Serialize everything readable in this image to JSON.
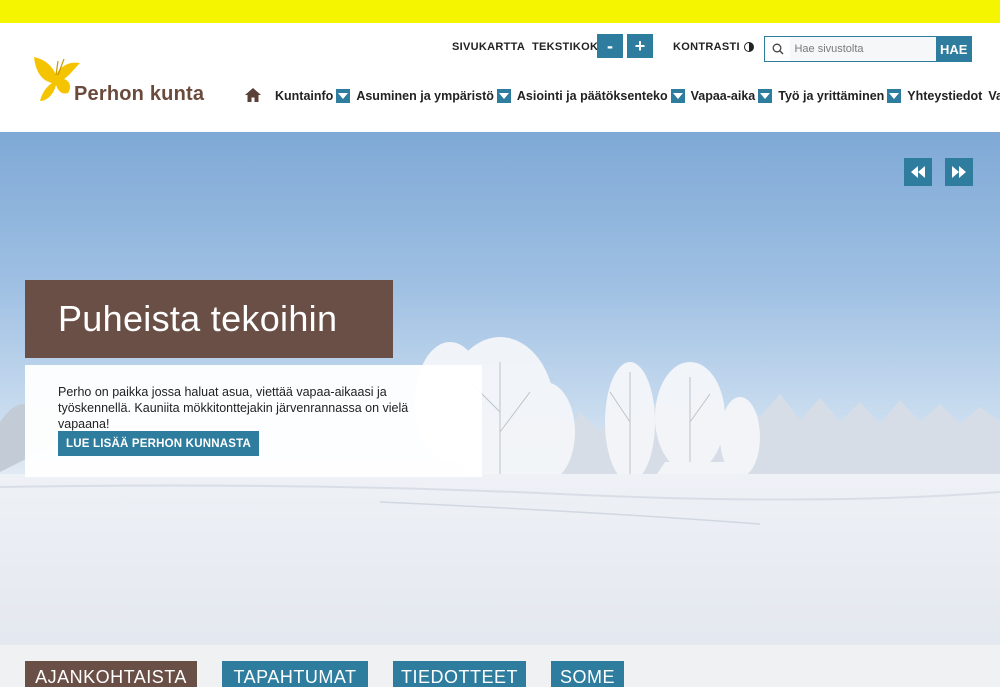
{
  "site": {
    "name": "Perhon kunta"
  },
  "utility": {
    "sitemap_label": "SIVUKARTTA",
    "textsize_label": "TEKSTIKOKO",
    "textsize_decrease": "-",
    "textsize_increase": "+",
    "contrast_label": "KONTRASTI"
  },
  "search": {
    "placeholder": "Hae sivustolta",
    "button_label": "HAE"
  },
  "nav": {
    "items": [
      {
        "label": "Kuntainfo",
        "has_dropdown": true
      },
      {
        "label": "Asuminen ja ympäristö",
        "has_dropdown": true
      },
      {
        "label": "Asiointi ja päätöksenteko",
        "has_dropdown": true
      },
      {
        "label": "Vapaa-aika",
        "has_dropdown": true
      },
      {
        "label": "Työ ja yrittäminen",
        "has_dropdown": true
      },
      {
        "label": "Yhteystiedot",
        "has_dropdown": false
      },
      {
        "label": "Vaalit",
        "has_dropdown": false
      }
    ]
  },
  "hero": {
    "title": "Puheista tekoihin",
    "text": "Perho on paikka jossa haluat asua, viettää vapaa-aikaasi ja työskennellä. Kauniita mökkitonttejakin järvenrannassa on vielä vapaana!",
    "cta_label": "LUE LISÄÄ PERHON KUNNASTA"
  },
  "tabs": [
    {
      "label": "AJANKOHTAISTA",
      "active": true
    },
    {
      "label": "TAPAHTUMAT",
      "active": false
    },
    {
      "label": "TIEDOTTEET",
      "active": false
    },
    {
      "label": "SOME",
      "active": false
    }
  ],
  "colors": {
    "accent_blue": "#2f7d9e",
    "accent_brown": "#6a4f47",
    "topbar_yellow": "#f5f500",
    "logo_yellow": "#f5c400"
  }
}
